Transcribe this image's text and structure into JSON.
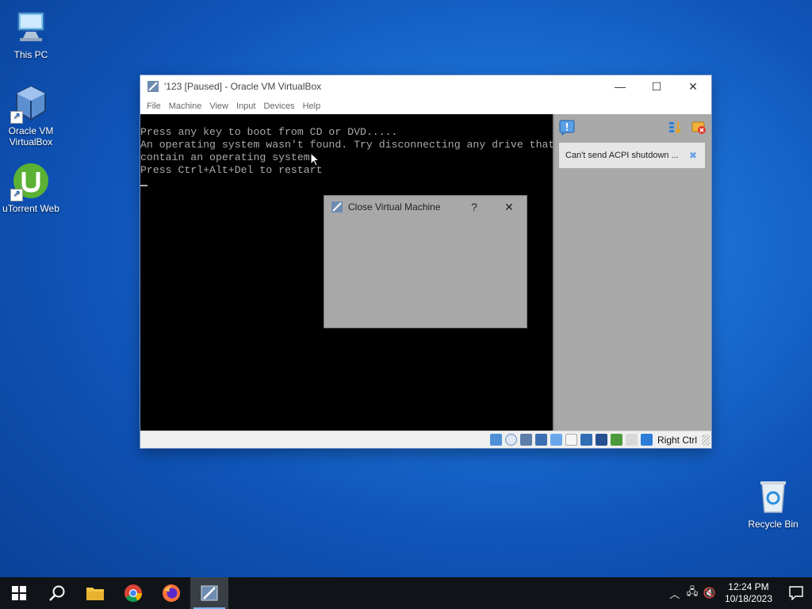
{
  "desktop": {
    "icons": [
      {
        "label": "This PC"
      },
      {
        "label": "Oracle VM VirtualBox"
      },
      {
        "label": "uTorrent Web"
      },
      {
        "label": "Recycle Bin"
      }
    ]
  },
  "vbox_window": {
    "title": "'123 [Paused] - Oracle VM VirtualBox",
    "menu": [
      "File",
      "Machine",
      "View",
      "Input",
      "Devices",
      "Help"
    ],
    "console_lines": [
      "Press any key to boot from CD or DVD.....",
      "An operating system wasn't found. Try disconnecting any drive that doesn't",
      "contain an operating system.",
      "Press Ctrl+Alt+Del to restart"
    ],
    "notification": {
      "message": "Can't send ACPI shutdown ..."
    },
    "status": {
      "host_key": "Right Ctrl"
    }
  },
  "dialog": {
    "title": "Close Virtual Machine",
    "help": "?",
    "close": "✕"
  },
  "taskbar": {
    "time": "12:24 PM",
    "date": "10/18/2023"
  },
  "colors": {
    "desktop_blue": "#1c6fd4",
    "taskbar_bg": "#101418",
    "console_text": "#aaaaaa"
  }
}
